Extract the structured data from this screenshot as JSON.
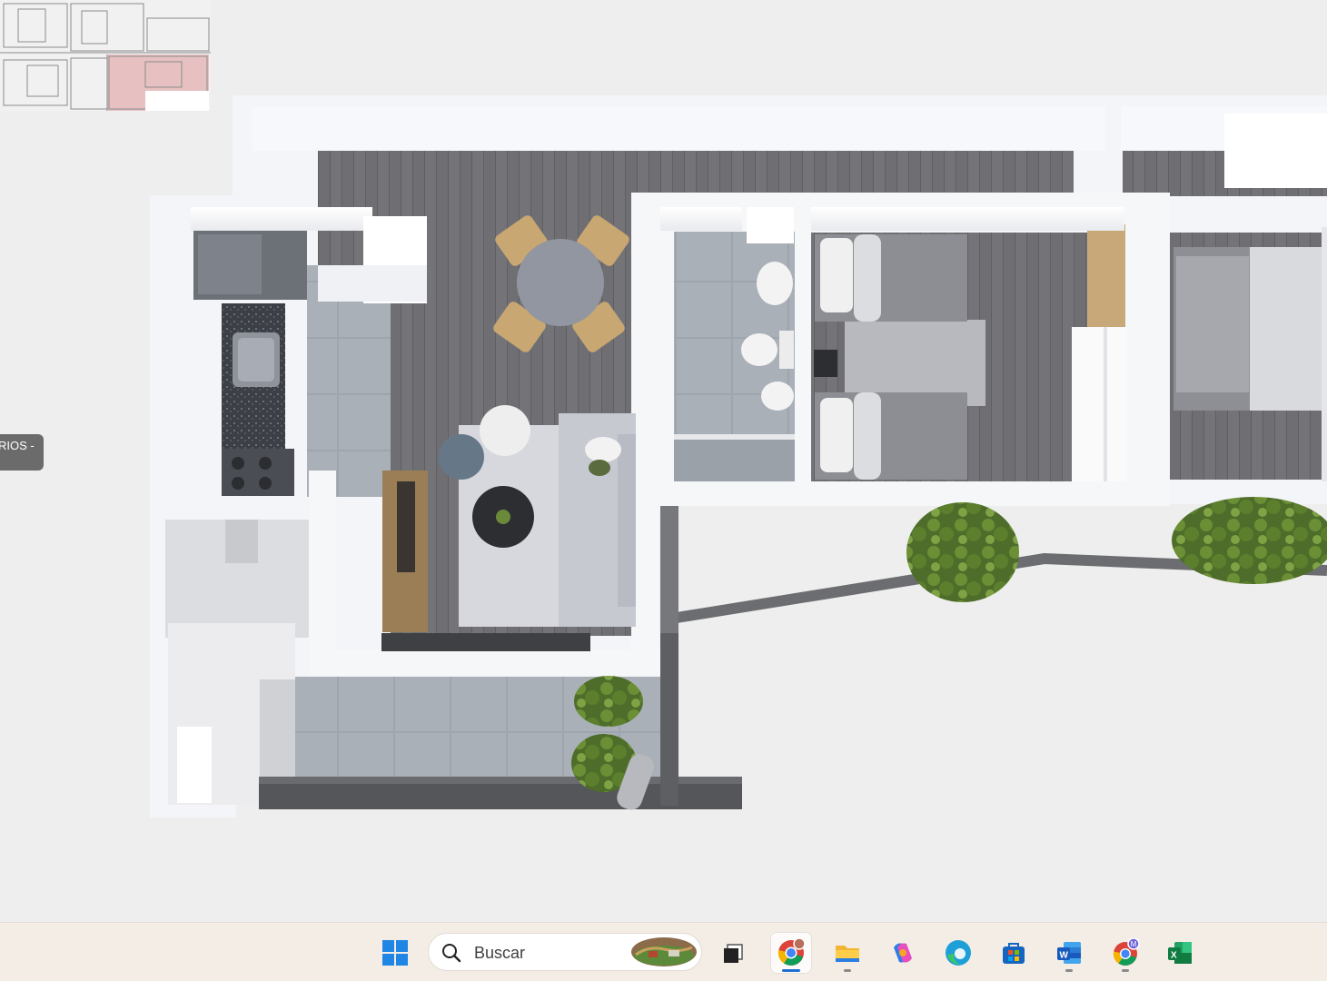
{
  "viewer": {
    "side_tab_label": "RIOS -"
  },
  "taskbar": {
    "search": {
      "placeholder": "Buscar",
      "value": ""
    },
    "apps": [
      {
        "name": "start",
        "icon": "windows-logo-icon"
      },
      {
        "name": "task-view",
        "icon": "task-view-icon"
      },
      {
        "name": "chrome",
        "icon": "chrome-icon",
        "active": true
      },
      {
        "name": "file-explorer",
        "icon": "folder-icon"
      },
      {
        "name": "copilot",
        "icon": "copilot-icon"
      },
      {
        "name": "edge",
        "icon": "edge-icon"
      },
      {
        "name": "microsoft-store",
        "icon": "store-icon"
      },
      {
        "name": "word",
        "icon": "word-icon"
      },
      {
        "name": "chrome-profile-m",
        "icon": "chrome-icon",
        "badge": "M"
      },
      {
        "name": "excel",
        "icon": "excel-icon"
      }
    ],
    "accent_color": "#1f6fd1"
  }
}
